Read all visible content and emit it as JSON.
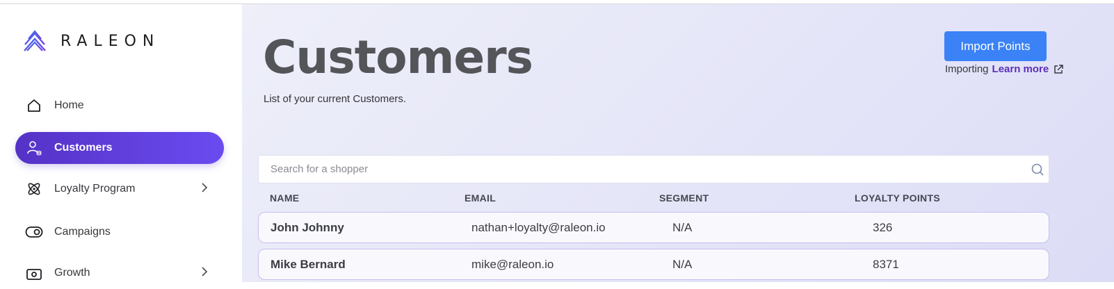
{
  "brand": {
    "name": "RALEON"
  },
  "sidebar": {
    "items": [
      {
        "label": "Home",
        "icon": "home-icon"
      },
      {
        "label": "Customers",
        "icon": "customers-icon",
        "active": true
      },
      {
        "label": "Loyalty Program",
        "icon": "loyalty-icon",
        "has_children": true
      },
      {
        "label": "Campaigns",
        "icon": "toggle-icon"
      },
      {
        "label": "Growth",
        "icon": "growth-icon",
        "has_children": true
      }
    ]
  },
  "header": {
    "title": "Customers",
    "subtitle": "List of your current Customers.",
    "import_button": "Import Points",
    "importing_label": "Importing",
    "learn_more": "Learn more"
  },
  "search": {
    "placeholder": "Search for a shopper"
  },
  "table": {
    "columns": [
      "NAME",
      "EMAIL",
      "SEGMENT",
      "LOYALTY POINTS"
    ],
    "rows": [
      {
        "name": "John Johnny",
        "email": "nathan+loyalty@raleon.io",
        "segment": "N/A",
        "points": "326"
      },
      {
        "name": "Mike Bernard",
        "email": "mike@raleon.io",
        "segment": "N/A",
        "points": "8371"
      }
    ]
  },
  "colors": {
    "accent": "#3b82f6",
    "active_nav": "#5d3ee0",
    "link": "#5a2fb8"
  }
}
